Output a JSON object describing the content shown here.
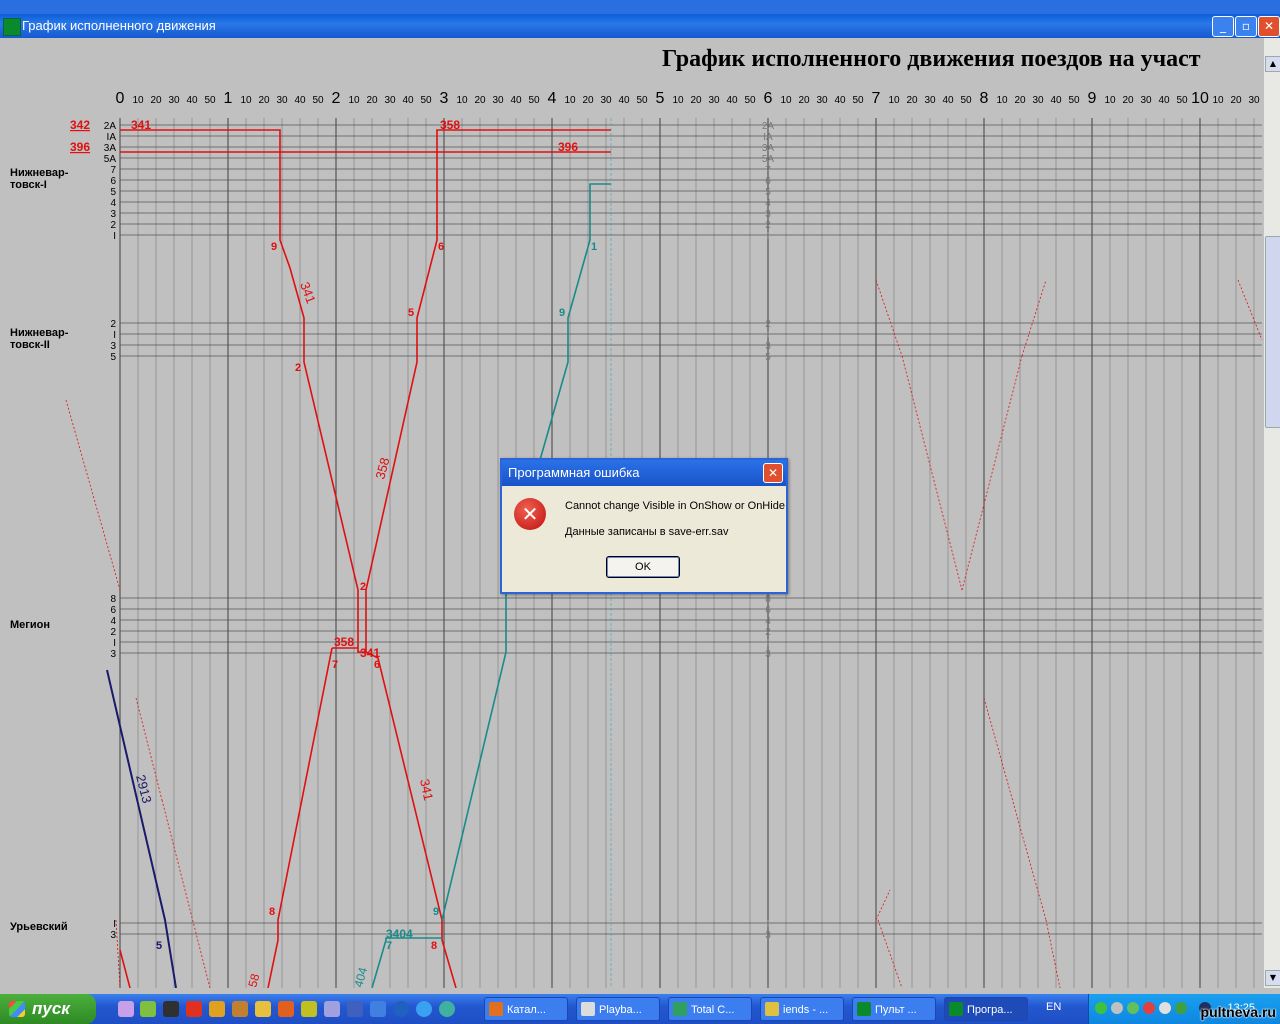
{
  "window": {
    "title": "График исполненного движения",
    "minimize": "_",
    "maximize": "▫",
    "close": "✕"
  },
  "chart": {
    "title": "График исполненного движения поездов на участ",
    "hour_labels": [
      "0",
      "1",
      "2",
      "3",
      "4",
      "5",
      "6",
      "7",
      "8",
      "9",
      "10"
    ],
    "minute_labels": [
      "10",
      "20",
      "30",
      "40",
      "50"
    ],
    "stations": [
      {
        "name_line1": "Нижневар-",
        "name_line2": "товск-I",
        "tracks": [
          "2А",
          "IА",
          "3А",
          "5А",
          "7",
          "6",
          "5",
          "4",
          "3",
          "2",
          "I"
        ]
      },
      {
        "name_line1": "Нижневар-",
        "name_line2": "товск-II",
        "tracks": [
          "2",
          "I",
          "3",
          "5"
        ]
      },
      {
        "name_line1": "Мегион",
        "name_line2": "",
        "tracks": [
          "8",
          "6",
          "4",
          "2",
          "I",
          "3"
        ]
      },
      {
        "name_line1": "Урьевский",
        "name_line2": "",
        "tracks": [
          "I",
          "3"
        ]
      }
    ],
    "train_labels": {
      "t342": "342",
      "t341": "341",
      "t358": "358",
      "t396": "396",
      "t396b": "396",
      "t341_slope": "341",
      "t358_slope": "358",
      "t341_lower": "341",
      "t358_meg": "358",
      "t341_meg": "341",
      "t2913": "2913",
      "t3404": "3404",
      "t404": "404",
      "t58": "58"
    },
    "track_marks": {
      "n9": "9",
      "n6": "6",
      "n1": "1",
      "n5": "5",
      "n9b": "9",
      "n2": "2",
      "n2b": "2",
      "n7": "7",
      "n6b": "6",
      "n8": "8",
      "n8b": "8",
      "n9c": "9",
      "n5b": "5",
      "n7b": "7"
    },
    "colors": {
      "red": "#e01010",
      "teal": "#1a8a8a",
      "navy": "#1a1a6a",
      "grid": "#7a7a7a",
      "bg": "#c0c0c0"
    }
  },
  "dialog": {
    "title": "Программная ошибка",
    "message": "Cannot change Visible in OnShow or OnHide",
    "detail": "Данные записаны в save-err.sav",
    "ok": "OK",
    "close": "✕"
  },
  "taskbar": {
    "start": "пуск",
    "buttons": [
      {
        "label": "Катал...",
        "color": "#e07020"
      },
      {
        "label": "Playba...",
        "color": "#dcdcdc"
      },
      {
        "label": "Total C...",
        "color": "#30a060"
      },
      {
        "label": "iends - ...",
        "color": "#e0c040"
      },
      {
        "label": "Пульт ...",
        "color": "#0a8a2a"
      },
      {
        "label": "Програ...",
        "color": "#0a8a2a"
      }
    ],
    "lang": "EN",
    "clock": "13:25"
  },
  "watermark": "pultneva.ru"
}
